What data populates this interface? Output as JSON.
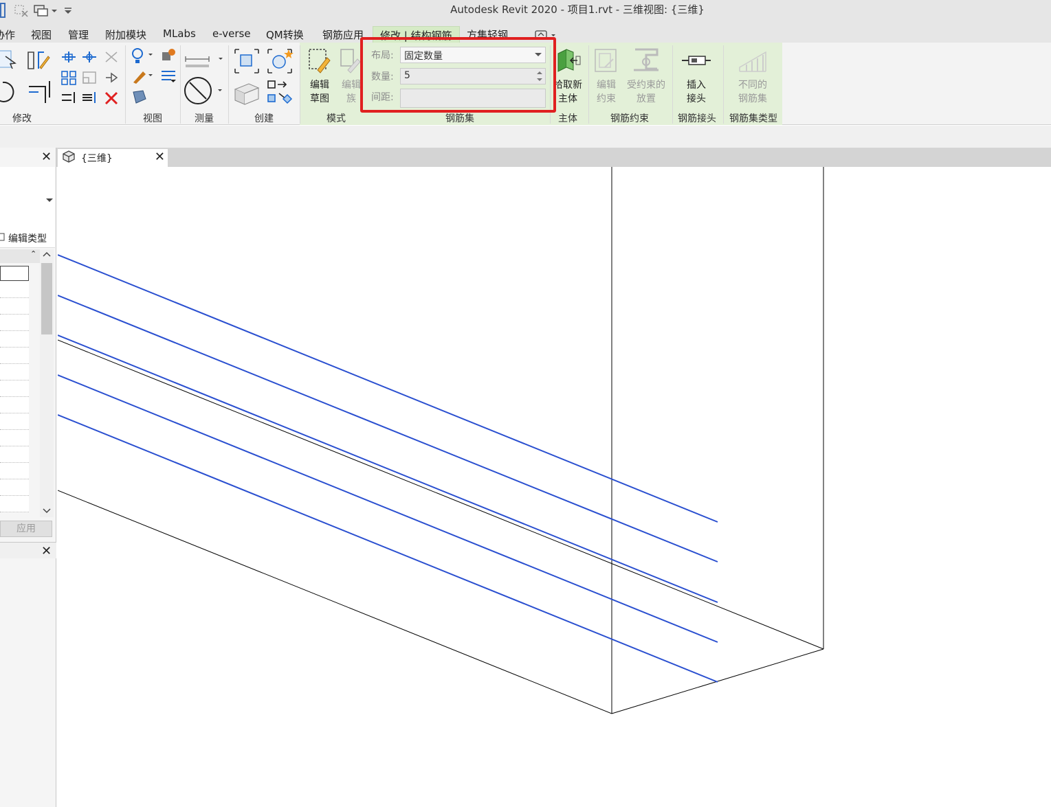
{
  "window": {
    "title": "Autodesk Revit 2020 - 项目1.rvt - 三维视图: {三维}"
  },
  "menu": {
    "tabs": [
      {
        "label": "协作"
      },
      {
        "label": "视图"
      },
      {
        "label": "管理"
      },
      {
        "label": "附加模块"
      },
      {
        "label": "MLabs"
      },
      {
        "label": "e-verse"
      },
      {
        "label": "QM转换"
      },
      {
        "label": "钢筋应用"
      },
      {
        "label": "修改 | 结构钢筋"
      },
      {
        "label": "方集轻钢"
      }
    ]
  },
  "ribbon": {
    "panels": {
      "modify": "修改",
      "view": "视图",
      "measure": "测量",
      "create": "创建",
      "mode": "模式",
      "rebar_set": "钢筋集",
      "host": "主体",
      "rebar_constraint": "钢筋约束",
      "rebar_coupler": "钢筋接头",
      "rebar_set_type": "钢筋集类型"
    },
    "buttons": {
      "edit_sketch_1": "编辑",
      "edit_sketch_2": "草图",
      "edit_family_1": "编辑",
      "edit_family_2": "族",
      "pick_host_1": "拾取新",
      "pick_host_2": "主体",
      "edit_constraint_1": "编辑",
      "edit_constraint_2": "约束",
      "constrained_place_1": "受约束的",
      "constrained_place_2": "放置",
      "insert_coupler_1": "插入",
      "insert_coupler_2": "接头",
      "varying_set_1": "不同的",
      "varying_set_2": "钢筋集"
    },
    "rebar_set": {
      "layout_label": "布局:",
      "layout_value": "固定数量",
      "quantity_label": "数量:",
      "quantity_value": "5",
      "spacing_label": "间距:",
      "spacing_value": ""
    }
  },
  "view_tab": {
    "label": "{三维}"
  },
  "properties": {
    "edit_type": "编辑类型",
    "apply": "应用"
  },
  "colors": {
    "rebar_line": "#2a4fd0",
    "edge_line": "#000000",
    "highlight_box": "#e02020",
    "context_tab": "#d6ebc6"
  }
}
